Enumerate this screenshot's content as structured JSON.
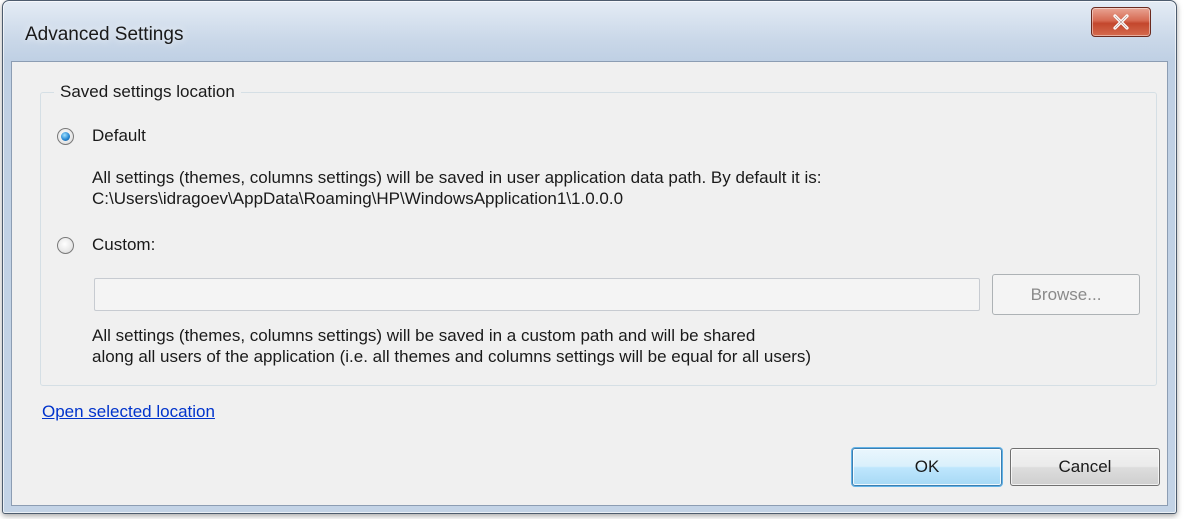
{
  "window": {
    "title": "Advanced Settings",
    "close_icon": "close-icon"
  },
  "group": {
    "legend": "Saved settings location"
  },
  "default_option": {
    "label": "Default",
    "checked": true,
    "description_line1": "All settings (themes, columns settings) will be saved in user application data path. By default it is:",
    "description_line2": "C:\\Users\\idragoev\\AppData\\Roaming\\HP\\WindowsApplication1\\1.0.0.0"
  },
  "custom_option": {
    "label": "Custom:",
    "checked": false,
    "path_value": "",
    "browse_label": "Browse...",
    "description_line1": "All settings (themes, columns settings) will be saved in a custom path and will be shared",
    "description_line2": "along all users of the application (i.e. all themes and columns settings will be equal for all users)"
  },
  "link": {
    "open_location": "Open selected location"
  },
  "buttons": {
    "ok": "OK",
    "cancel": "Cancel"
  },
  "colors": {
    "link": "#0033cc",
    "close_button": "#c3472d",
    "default_button_border": "#3c7fb1"
  }
}
